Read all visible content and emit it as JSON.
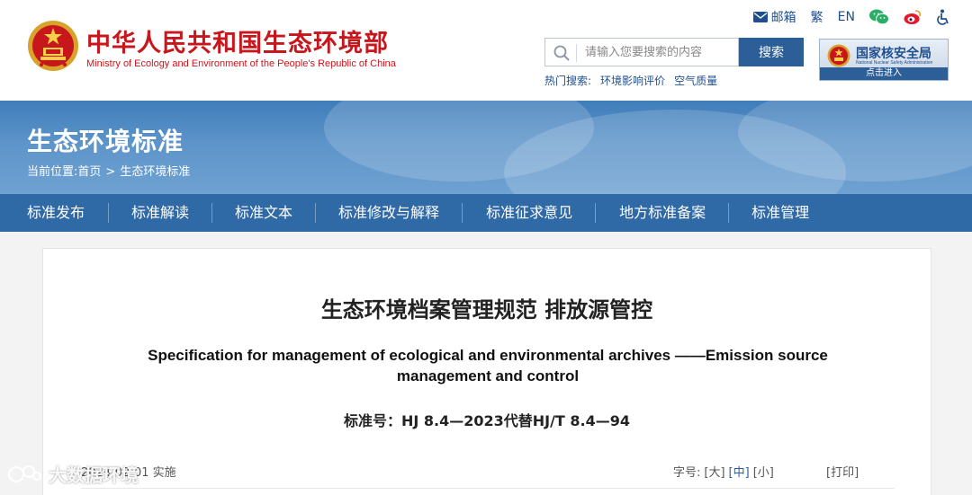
{
  "header": {
    "ministry_cn": "中华人民共和国生态环境部",
    "ministry_en": "Ministry of Ecology and Environment of the People's Republic of China",
    "util": {
      "mail_label": "邮箱",
      "traditional_label": "繁",
      "english_label": "EN",
      "icons": [
        "mail-icon",
        "wechat-icon",
        "weibo-icon",
        "accessibility-icon"
      ]
    },
    "search": {
      "placeholder": "请输入您要搜索的内容",
      "button_label": "搜索"
    },
    "hot_search": {
      "label": "热门搜索:",
      "items": [
        "环境影响评价",
        "空气质量"
      ]
    },
    "nnsa": {
      "name_cn": "国家核安全局",
      "name_en": "National Nuclear Safety Administration",
      "enter_label": "点击进入"
    }
  },
  "banner": {
    "title": "生态环境标准",
    "breadcrumb": {
      "prefix": "当前位置:",
      "home": "首页",
      "separator": ">",
      "current": "生态环境标准"
    }
  },
  "nav": {
    "tabs": [
      "标准发布",
      "标准解读",
      "标准文本",
      "标准修改与解释",
      "标准征求意见",
      "地方标准备案",
      "标准管理"
    ]
  },
  "article": {
    "title_cn": "生态环境档案管理规范 排放源管控",
    "title_en": "Specification for management of ecological and environmental archives ——Emission source management and control",
    "standard_code": "标准号：HJ 8.4—2023代替HJ/T 8.4—94",
    "effective_date": "2024-02-01 实施",
    "font_size_label": "字号:",
    "font_options": [
      "[大]",
      "[中]",
      "[小]"
    ],
    "active_font": "[中]",
    "print_label": "[打印]"
  },
  "watermark": {
    "text": "大数据环境"
  },
  "colors": {
    "brand_red": "#c8161d",
    "nav_blue": "#2f69a6",
    "link_blue": "#1f4f8e"
  }
}
